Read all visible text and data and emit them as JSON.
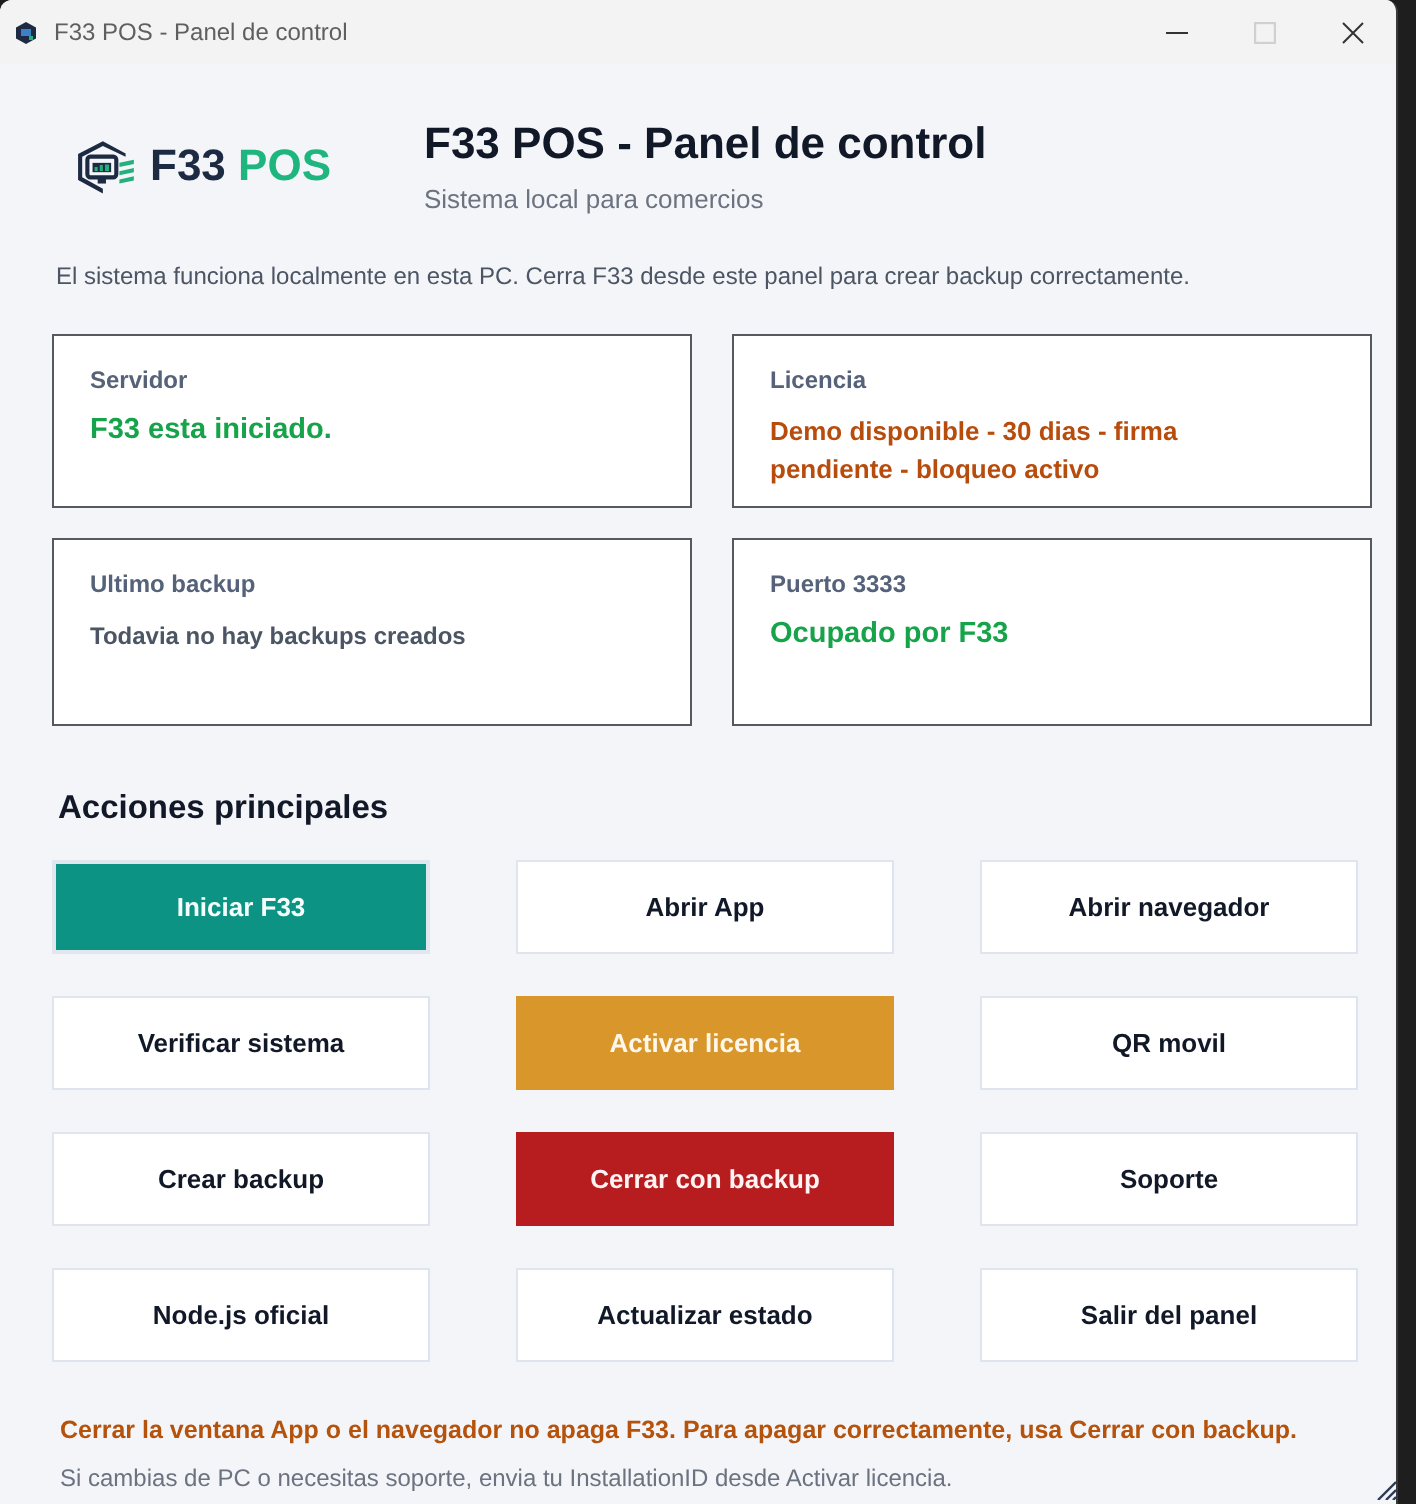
{
  "window": {
    "title": "F33 POS - Panel de control",
    "controls": [
      {
        "kind": "minimize",
        "disabled": false
      },
      {
        "kind": "maximize",
        "disabled": true
      },
      {
        "kind": "close",
        "disabled": false
      }
    ]
  },
  "header": {
    "logo": {
      "name": "F33",
      "suffix": "POS"
    },
    "title": "F33 POS - Panel de control",
    "subtitle": "Sistema local para comercios"
  },
  "intro": "El sistema funciona localmente en esta PC. Cerra F33 desde este panel para crear backup correctamente.",
  "status_cards": [
    {
      "label": "Servidor",
      "value": "F33 esta iniciado.",
      "kind": "success"
    },
    {
      "label": "Licencia",
      "value": "Demo disponible - 30 dias - firma pendiente - bloqueo activo",
      "kind": "warning"
    },
    {
      "label": "Ultimo backup",
      "value": "Todavia no hay backups creados",
      "kind": "muted"
    },
    {
      "label": "Puerto 3333",
      "value": "Ocupado por F33",
      "kind": "success"
    }
  ],
  "actions": {
    "title": "Acciones principales",
    "buttons": [
      {
        "label": "Iniciar F33",
        "kind": "primary"
      },
      {
        "label": "Abrir App",
        "kind": "default"
      },
      {
        "label": "Abrir navegador",
        "kind": "default"
      },
      {
        "label": "Verificar sistema",
        "kind": "default"
      },
      {
        "label": "Activar licencia",
        "kind": "warning"
      },
      {
        "label": "QR movil",
        "kind": "default"
      },
      {
        "label": "Crear backup",
        "kind": "default"
      },
      {
        "label": "Cerrar con backup",
        "kind": "danger"
      },
      {
        "label": "Soporte",
        "kind": "default"
      },
      {
        "label": "Node.js oficial",
        "kind": "default"
      },
      {
        "label": "Actualizar estado",
        "kind": "default"
      },
      {
        "label": "Salir del panel",
        "kind": "default"
      }
    ]
  },
  "footer": {
    "warning": "Cerrar la ventana App o el navegador no apaga F33. Para apagar correctamente, usa Cerrar con backup.",
    "note": "Si cambias de PC o necesitas soporte, envia tu InstallationID desde Activar licencia."
  }
}
